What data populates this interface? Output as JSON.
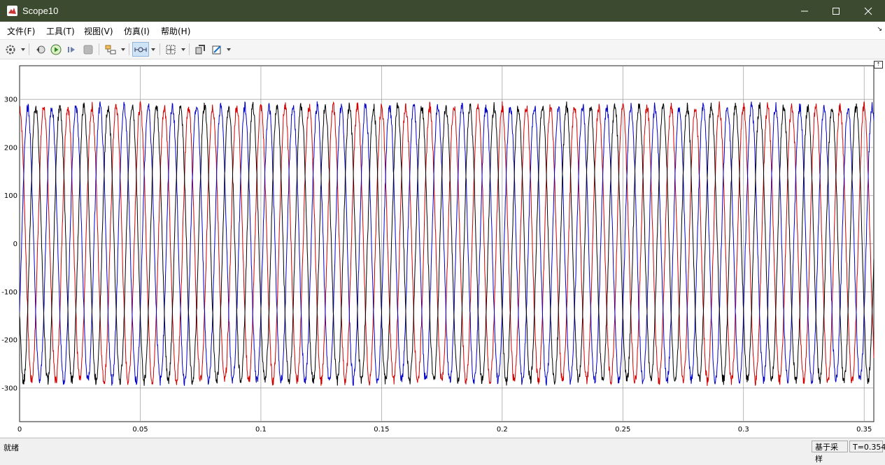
{
  "window": {
    "title": "Scope10"
  },
  "menu": [
    "文件(F)",
    "工具(T)",
    "视图(V)",
    "仿真(I)",
    "帮助(H)"
  ],
  "toolbar": {
    "buttons": [
      "settings-icon",
      "step-back-icon",
      "run-icon",
      "step-forward-icon",
      "stop-icon",
      "highlight-icon",
      "zoom-time-icon",
      "fit-to-view-icon",
      "restore-layout-icon",
      "style-icon"
    ]
  },
  "colors": {
    "series1": "#d00000",
    "series2": "#0000c8",
    "series3": "#000000",
    "grid": "#9a9a9a",
    "titlebar": "#3c4a2f"
  },
  "chart_data": {
    "type": "line",
    "x_ticks": [
      "0",
      "0.05",
      "0.1",
      "0.15",
      "0.2",
      "0.25",
      "0.3",
      "0.35"
    ],
    "y_ticks": [
      "300",
      "200",
      "100",
      "0",
      "-100",
      "-200",
      "-300"
    ],
    "xlim": [
      0,
      0.354
    ],
    "ylim": [
      -370,
      370
    ],
    "grid": true,
    "series": [
      {
        "color": "red",
        "amplitude": 285,
        "frequency": 100,
        "phase_deg": 90
      },
      {
        "color": "blue",
        "amplitude": 285,
        "frequency": 100,
        "phase_deg": -30
      },
      {
        "color": "black",
        "amplitude": 285,
        "frequency": 100,
        "phase_deg": 210
      }
    ]
  },
  "status": {
    "left": "就绪",
    "mode": "基于采样",
    "time": "T=0.354"
  }
}
